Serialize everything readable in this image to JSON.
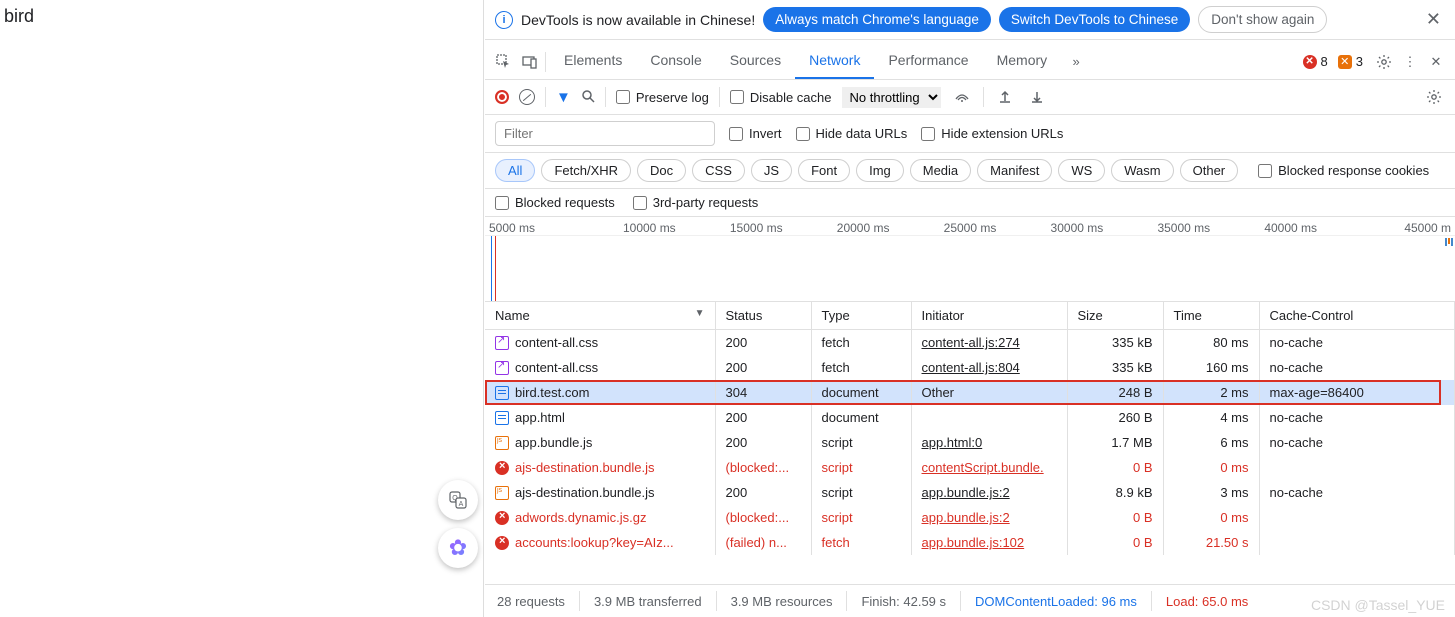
{
  "page": {
    "body_text": "bird"
  },
  "infobar": {
    "message": "DevTools is now available in Chinese!",
    "btn_match": "Always match Chrome's language",
    "btn_switch": "Switch DevTools to Chinese",
    "btn_dismiss": "Don't show again"
  },
  "tabs": {
    "items": [
      "Elements",
      "Console",
      "Sources",
      "Network",
      "Performance",
      "Memory"
    ],
    "active": "Network",
    "errors_count": "8",
    "warnings_count": "3"
  },
  "net_toolbar": {
    "preserve_log": "Preserve log",
    "disable_cache": "Disable cache",
    "throttling": "No throttling"
  },
  "filters": {
    "filter_placeholder": "Filter",
    "invert": "Invert",
    "hide_data_urls": "Hide data URLs",
    "hide_ext_urls": "Hide extension URLs"
  },
  "chips": {
    "items": [
      "All",
      "Fetch/XHR",
      "Doc",
      "CSS",
      "JS",
      "Font",
      "Img",
      "Media",
      "Manifest",
      "WS",
      "Wasm",
      "Other"
    ],
    "blocked_cookies": "Blocked response cookies"
  },
  "extra": {
    "blocked_requests": "Blocked requests",
    "third_party": "3rd-party requests"
  },
  "timeline": {
    "ticks": [
      "5000 ms",
      "10000 ms",
      "15000 ms",
      "20000 ms",
      "25000 ms",
      "30000 ms",
      "35000 ms",
      "40000 ms",
      "45000 m"
    ]
  },
  "columns": [
    "Name",
    "Status",
    "Type",
    "Initiator",
    "Size",
    "Time",
    "Cache-Control"
  ],
  "rows": [
    {
      "icon": "css",
      "name": "content-all.css",
      "status": "200",
      "type": "fetch",
      "initiator": "content-all.js:274",
      "size": "335 kB",
      "time": "80 ms",
      "cache": "no-cache"
    },
    {
      "icon": "css",
      "name": "content-all.css",
      "status": "200",
      "type": "fetch",
      "initiator": "content-all.js:804",
      "size": "335 kB",
      "time": "160 ms",
      "cache": "no-cache"
    },
    {
      "icon": "doc",
      "name": "bird.test.com",
      "status": "304",
      "type": "document",
      "initiator": "Other",
      "size": "248 B",
      "time": "2 ms",
      "cache": "max-age=86400",
      "selected": true,
      "highlight": true
    },
    {
      "icon": "doc",
      "name": "app.html",
      "status": "200",
      "type": "document",
      "initiator": "",
      "size": "260 B",
      "time": "4 ms",
      "cache": "no-cache"
    },
    {
      "icon": "js",
      "name": "app.bundle.js",
      "status": "200",
      "type": "script",
      "initiator": "app.html:0",
      "size": "1.7 MB",
      "time": "6 ms",
      "cache": "no-cache"
    },
    {
      "icon": "err",
      "name": "ajs-destination.bundle.js",
      "status": "(blocked:...",
      "type": "script",
      "initiator": "contentScript.bundle.",
      "size": "0 B",
      "time": "0 ms",
      "cache": "",
      "error": true
    },
    {
      "icon": "js",
      "name": "ajs-destination.bundle.js",
      "status": "200",
      "type": "script",
      "initiator": "app.bundle.js:2",
      "size": "8.9 kB",
      "time": "3 ms",
      "cache": "no-cache"
    },
    {
      "icon": "err",
      "name": "adwords.dynamic.js.gz",
      "status": "(blocked:...",
      "type": "script",
      "initiator": "app.bundle.js:2",
      "size": "0 B",
      "time": "0 ms",
      "cache": "",
      "error": true
    },
    {
      "icon": "err",
      "name": "accounts:lookup?key=AIz...",
      "status": "(failed) n...",
      "type": "fetch",
      "initiator": "app.bundle.js:102",
      "size": "0 B",
      "time": "21.50 s",
      "cache": "",
      "error": true
    }
  ],
  "statusbar": {
    "requests": "28 requests",
    "transferred": "3.9 MB transferred",
    "resources": "3.9 MB resources",
    "finish": "Finish: 42.59 s",
    "domloaded": "DOMContentLoaded: 96 ms",
    "load": "Load: 65.0 ms"
  },
  "watermark": "CSDN @Tassel_YUE"
}
